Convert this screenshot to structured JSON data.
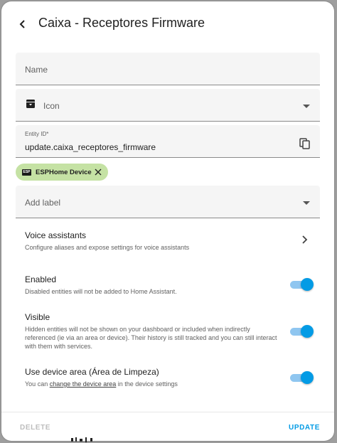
{
  "dialog": {
    "title": "Caixa - Receptores Firmware"
  },
  "name_field": {
    "placeholder": "Name"
  },
  "icon_field": {
    "label": "Icon"
  },
  "entity_id_field": {
    "label": "Entity ID*",
    "value": "update.caixa_receptores_firmware"
  },
  "labels_chip": {
    "icon_text": "ESP",
    "label": "ESPHome Device"
  },
  "add_label": {
    "placeholder": "Add label"
  },
  "voice_assistants": {
    "title": "Voice assistants",
    "description": "Configure aliases and expose settings for voice assistants"
  },
  "enabled": {
    "title": "Enabled",
    "description": "Disabled entities will not be added to Home Assistant.",
    "on": true
  },
  "visible": {
    "title": "Visible",
    "description": "Hidden entities will not be shown on your dashboard or included when indirectly referenced (ie via an area or device). Their history is still tracked and you can still interact with them with services.",
    "on": true
  },
  "device_area": {
    "title": "Use device area (Área de Limpeza)",
    "description_prefix": "You can ",
    "link": "change the device area",
    "description_suffix": " in the device settings",
    "on": true
  },
  "footer": {
    "delete_label": "DELETE",
    "update_label": "UPDATE"
  },
  "colors": {
    "accent": "#039be5",
    "chip_bg": "#c5e2a4",
    "disabled_text": "#bdbdbd"
  }
}
